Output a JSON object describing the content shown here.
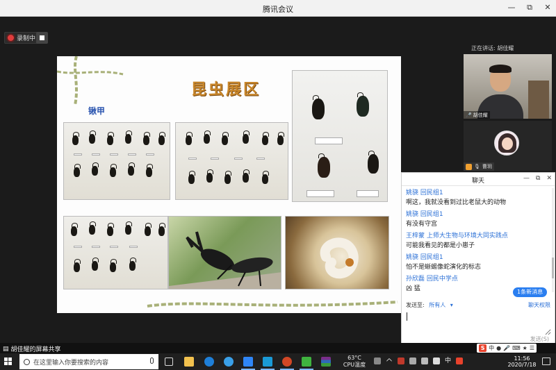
{
  "window": {
    "title": "腾讯会议",
    "controls": [
      "—",
      "⧉",
      "✕"
    ]
  },
  "recording": {
    "label": "录制中"
  },
  "slide": {
    "title": "昆虫展区",
    "subtitle": "锹甲"
  },
  "speaker": {
    "label": "正在讲话: 胡佳耀",
    "main_name": "胡佳耀",
    "second_name": "曹玥"
  },
  "chat": {
    "title": "聊天",
    "messages": [
      {
        "who": "姚骁 回民组1",
        "text": "啊这，我就没看到过比老鼠大的动物"
      },
      {
        "who": "姚骁 回民组1",
        "text": "有没有守宫"
      },
      {
        "who": "王梓蒙  上师大生物与环境大同实践点",
        "text": "可能我看见的都是小崽子"
      },
      {
        "who": "姚骁 回民组1",
        "text": "怕不是蜥蜴像蛇演化的标志"
      },
      {
        "who": "孙欣磊 回民中学点",
        "text": "凶 猛"
      }
    ],
    "new_msg": "1条新消息",
    "send_to_label": "发送至:",
    "send_to_value": "所有人",
    "permission": "聊天权限",
    "input_value": "",
    "send_button": "发送(S)"
  },
  "share_bar": {
    "label": "胡佳耀的屏幕共享"
  },
  "ime": {
    "brand": "S",
    "lang": "中"
  },
  "taskbar": {
    "search_placeholder": "在这里输入你要搜索的内容",
    "weather_temp": "63°C",
    "weather_label": "CPU温度",
    "tray_lang": "中",
    "time": "11:56",
    "date": "2020/7/18"
  }
}
